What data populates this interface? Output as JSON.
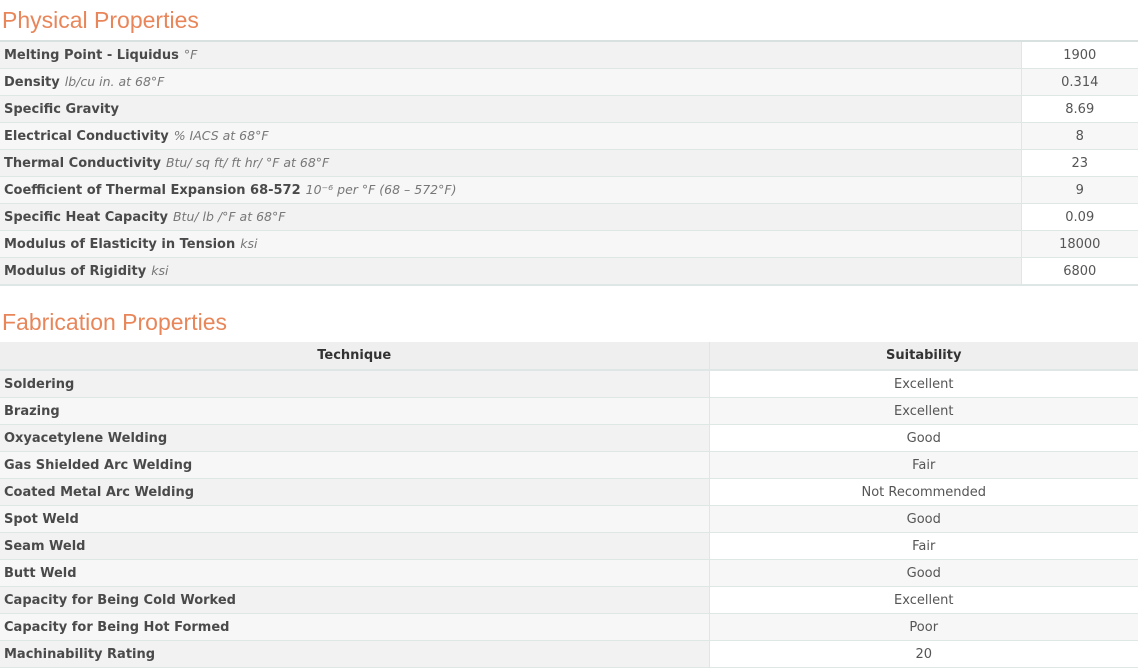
{
  "physical": {
    "title": "Physical Properties",
    "rows": [
      {
        "label": "Melting Point - Liquidus",
        "unit": "°F",
        "value": "1900"
      },
      {
        "label": "Density",
        "unit": "lb/cu in. at 68°F",
        "value": "0.314"
      },
      {
        "label": "Specific Gravity",
        "unit": "",
        "value": "8.69"
      },
      {
        "label": "Electrical Conductivity",
        "unit": "% IACS at 68°F",
        "value": "8"
      },
      {
        "label": "Thermal Conductivity",
        "unit": "Btu/ sq ft/ ft hr/ °F at 68°F",
        "value": "23"
      },
      {
        "label": "Coefficient of Thermal Expansion 68-572",
        "unit": "10⁻⁶ per °F (68 – 572°F)",
        "value": "9"
      },
      {
        "label": "Specific Heat Capacity",
        "unit": "Btu/ lb /°F at 68°F",
        "value": "0.09"
      },
      {
        "label": "Modulus of Elasticity in Tension",
        "unit": "ksi",
        "value": "18000"
      },
      {
        "label": "Modulus of Rigidity",
        "unit": "ksi",
        "value": "6800"
      }
    ]
  },
  "fabrication": {
    "title": "Fabrication Properties",
    "headers": {
      "technique": "Technique",
      "suitability": "Suitability"
    },
    "rows": [
      {
        "technique": "Soldering",
        "suitability": "Excellent"
      },
      {
        "technique": "Brazing",
        "suitability": "Excellent"
      },
      {
        "technique": "Oxyacetylene Welding",
        "suitability": "Good"
      },
      {
        "technique": "Gas Shielded Arc Welding",
        "suitability": "Fair"
      },
      {
        "technique": "Coated Metal Arc Welding",
        "suitability": "Not Recommended"
      },
      {
        "technique": "Spot Weld",
        "suitability": "Good"
      },
      {
        "technique": "Seam Weld",
        "suitability": "Fair"
      },
      {
        "technique": "Butt Weld",
        "suitability": "Good"
      },
      {
        "technique": "Capacity for Being Cold Worked",
        "suitability": "Excellent"
      },
      {
        "technique": "Capacity for Being Hot Formed",
        "suitability": "Poor"
      },
      {
        "technique": "Machinability Rating",
        "suitability": "20"
      }
    ]
  }
}
